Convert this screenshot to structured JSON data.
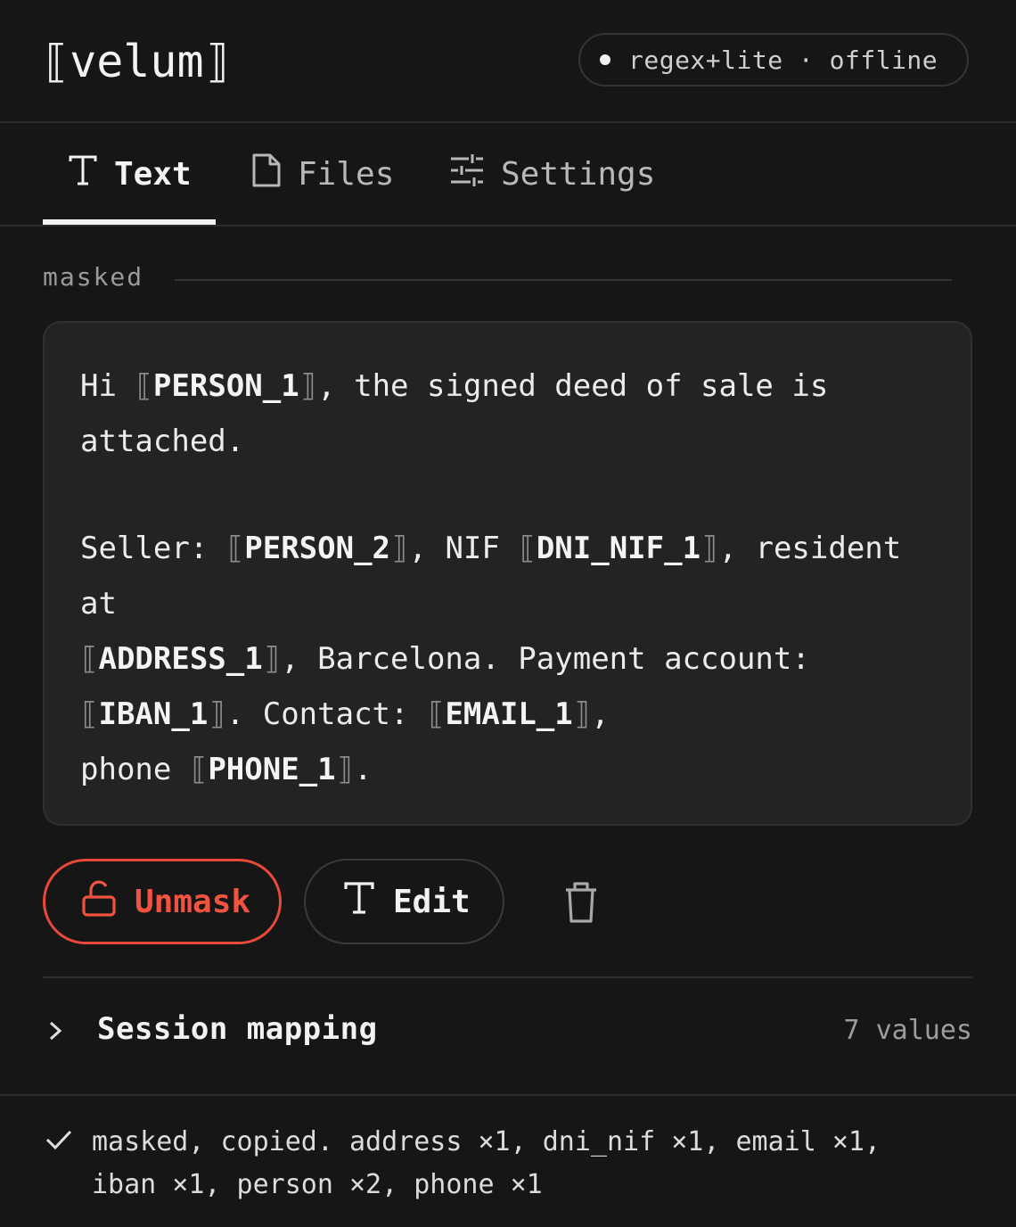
{
  "app": {
    "logo": "⟦velum⟧",
    "status": "regex+lite · offline"
  },
  "tabs": [
    {
      "label": "Text",
      "icon": "text-icon",
      "active": true
    },
    {
      "label": "Files",
      "icon": "file-icon",
      "active": false
    },
    {
      "label": "Settings",
      "icon": "sliders-icon",
      "active": false
    }
  ],
  "masked": {
    "section_label": "masked",
    "brackets": {
      "open": "⟦",
      "close": "⟧"
    },
    "lines": [
      [
        {
          "t": "Hi "
        },
        {
          "tok": "PERSON_1"
        },
        {
          "t": ", the signed deed of sale is"
        }
      ],
      [
        {
          "t": "attached."
        }
      ],
      [],
      [
        {
          "t": "Seller: "
        },
        {
          "tok": "PERSON_2"
        },
        {
          "t": ", NIF "
        },
        {
          "tok": "DNI_NIF_1"
        },
        {
          "t": ", resident"
        }
      ],
      [
        {
          "t": "at"
        }
      ],
      [
        {
          "tok": "ADDRESS_1"
        },
        {
          "t": ", Barcelona. Payment account:"
        }
      ],
      [
        {
          "tok": "IBAN_1"
        },
        {
          "t": ". Contact: "
        },
        {
          "tok": "EMAIL_1"
        },
        {
          "t": ","
        }
      ],
      [
        {
          "t": "phone "
        },
        {
          "tok": "PHONE_1"
        },
        {
          "t": "."
        }
      ]
    ]
  },
  "actions": {
    "unmask_label": "Unmask",
    "edit_label": "Edit",
    "colors": {
      "unmask": "#e8493a"
    }
  },
  "mapping": {
    "title": "Session mapping",
    "count": "7 values"
  },
  "footer": {
    "text": "masked, copied. address ×1, dni_nif ×1, email ×1,\niban ×1, person ×2, phone ×1"
  }
}
